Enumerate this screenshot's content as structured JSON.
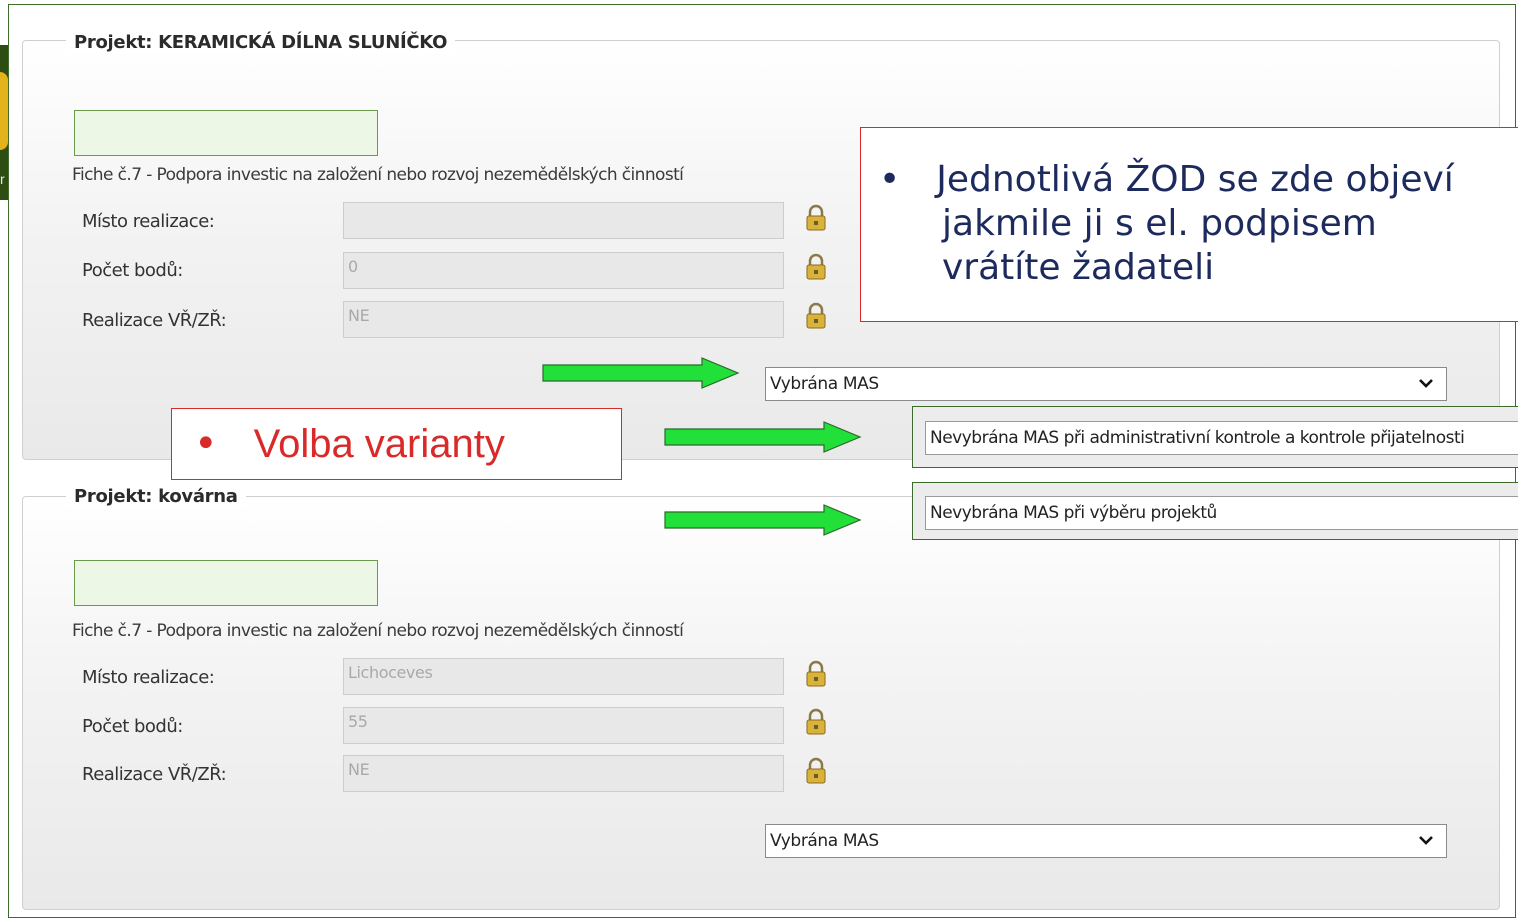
{
  "projects": [
    {
      "title": "Projekt: KERAMICKÁ DÍLNA SLUNÍČKO",
      "fiche": "Fiche č.7 - Podpora investic na založení nebo rozvoj nezemědělských činností",
      "fields": [
        {
          "label": "Místo realizace:",
          "value": ""
        },
        {
          "label": "Počet bodů:",
          "value": "0"
        },
        {
          "label": "Realizace VŘ/ZŘ:",
          "value": "NE"
        }
      ],
      "selected": "Vybrána MAS"
    },
    {
      "title": "Projekt: kovárna",
      "fiche": "Fiche č.7 - Podpora investic na založení nebo rozvoj nezemědělských činností",
      "fields": [
        {
          "label": "Místo realizace:",
          "value": "Lichoceves"
        },
        {
          "label": "Počet bodů:",
          "value": "55"
        },
        {
          "label": "Realizace VŘ/ZŘ:",
          "value": "NE"
        }
      ],
      "selected": "Vybrána MAS"
    }
  ],
  "dropdown_options": [
    "Nevybrána MAS při administrativní kontrole a kontrole přijatelnosti",
    "Nevybrána MAS při výběru projektů"
  ],
  "callouts": {
    "zod_line1": "Jednotlivá ŽOD se zde objeví",
    "zod_line2": "jakmile ji s el. podpisem",
    "zod_line3": "vrátíte žadateli",
    "volba": "Volba varianty",
    "bullet": "•"
  },
  "colors": {
    "frame_green": "#3d6b2c",
    "arrow_green": "#22e03a",
    "callout_red": "#d92a2a",
    "callout_text_navy": "#1d2a5e",
    "field_bg": "#e8e8e8"
  },
  "icons": {
    "lock": "lock-icon",
    "chevron": "chevron-down-icon",
    "arrow": "arrow-right-icon"
  }
}
